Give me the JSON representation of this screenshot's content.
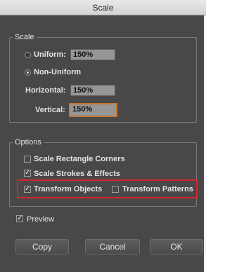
{
  "window": {
    "title": "Scale"
  },
  "scale_group": {
    "legend": "Scale",
    "uniform_label": "Uniform:",
    "uniform_value": "150%",
    "nonuniform_label": "Non-Uniform",
    "horizontal_label": "Horizontal:",
    "horizontal_value": "150%",
    "vertical_label": "Vertical:",
    "vertical_value": "150%",
    "selected_mode": "Non-Uniform"
  },
  "options_group": {
    "legend": "Options",
    "scale_rect_corners": {
      "label": "Scale Rectangle Corners",
      "checked": false
    },
    "scale_strokes": {
      "label": "Scale Strokes & Effects",
      "checked": true
    },
    "transform_objects": {
      "label": "Transform Objects",
      "checked": true
    },
    "transform_patterns": {
      "label": "Transform Patterns",
      "checked": false
    }
  },
  "preview": {
    "label": "Preview",
    "checked": true
  },
  "buttons": {
    "copy": "Copy",
    "cancel": "Cancel",
    "ok": "OK"
  },
  "colors": {
    "panel": "#484848",
    "highlight": "#d8232a",
    "active_field": "#c8752f"
  }
}
